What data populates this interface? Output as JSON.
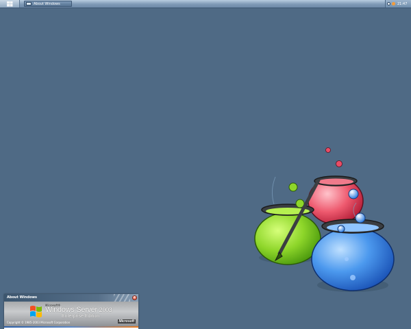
{
  "taskbar": {
    "task_button_label": "About Windows",
    "clock": "21:47"
  },
  "about_window": {
    "title": "About Windows",
    "brand_small": "Microsoft®",
    "product": "Windows Server",
    "year": "2003",
    "edition": "Enterprise Edition",
    "copyright": "Copyright © 1985-2003  Microsoft Corporation",
    "vendor_logo": "Microsoft"
  },
  "icons": {
    "start": "windows-logo-icon",
    "task": "window-icon",
    "tray": [
      "network-icon",
      "security-shield-icon"
    ],
    "close": "close-icon"
  },
  "colors": {
    "desktop": "#4f6a85",
    "cauldron_green": "#7fcf1f",
    "cauldron_red": "#e8435c",
    "cauldron_blue": "#3f8ee8"
  }
}
